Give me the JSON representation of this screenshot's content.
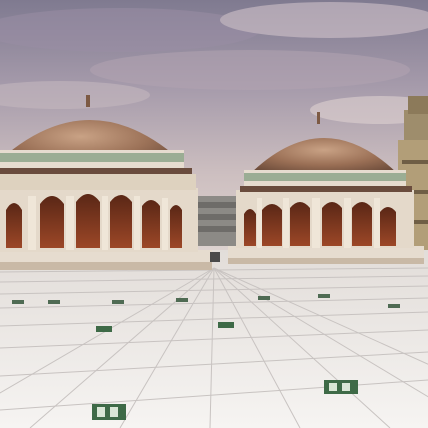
{
  "scene": {
    "colors": {
      "sky_top": "#8a8296",
      "sky_mid": "#b9aeb6",
      "sky_low": "#d9cfcd",
      "dome_copper": "#a77a5e",
      "dome_shadow": "#6b4a3a",
      "stone": "#e7ddd0",
      "stone_shadow": "#bfae9c",
      "arch_wood": "#8a3b22",
      "tile": "#f2efec",
      "tile_line": "#c9c4c2",
      "marker_green": "#3e6a47"
    }
  }
}
